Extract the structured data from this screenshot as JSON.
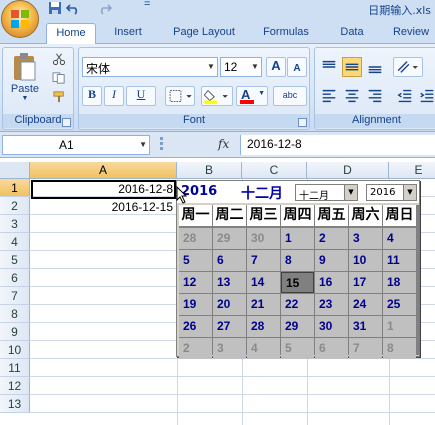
{
  "window": {
    "title": "日期输入.xls",
    "qa_more": "="
  },
  "tabs": [
    "Home",
    "Insert",
    "Page Layout",
    "Formulas",
    "Data",
    "Review"
  ],
  "ribbon": {
    "clipboard": {
      "paste": "Paste",
      "label": "Clipboard"
    },
    "font": {
      "name": "宋体",
      "size": "12",
      "grow": "A",
      "shrink": "A",
      "bold": "B",
      "italic": "I",
      "underline": "U",
      "font_color": "A",
      "phonetic": "abc",
      "label": "Font"
    },
    "alignment": {
      "label": "Alignment"
    }
  },
  "formula_bar": {
    "name_box": "A1",
    "fx": "fx",
    "formula": "2016-12-8"
  },
  "sheet": {
    "columns": [
      "A",
      "B",
      "C",
      "D",
      "E"
    ],
    "rows": [
      "1",
      "2",
      "3",
      "4",
      "5",
      "6",
      "7",
      "8",
      "9",
      "10",
      "11",
      "12",
      "13"
    ],
    "cells": {
      "A1": "2016-12-8",
      "A2": "2016-12-15"
    }
  },
  "calendar": {
    "year_label": "2016",
    "month_label": "十二月",
    "month_select": "十二月",
    "year_select": "2016",
    "weekdays": [
      "周一",
      "周二",
      "周三",
      "周四",
      "周五",
      "周六",
      "周日"
    ],
    "days": [
      [
        "28",
        "29",
        "30",
        "1",
        "2",
        "3",
        "4"
      ],
      [
        "5",
        "6",
        "7",
        "8",
        "9",
        "10",
        "11"
      ],
      [
        "12",
        "13",
        "14",
        "15",
        "16",
        "17",
        "18"
      ],
      [
        "19",
        "20",
        "21",
        "22",
        "23",
        "24",
        "25"
      ],
      [
        "26",
        "27",
        "28",
        "29",
        "30",
        "31",
        "1"
      ],
      [
        "2",
        "3",
        "4",
        "5",
        "6",
        "7",
        "8"
      ]
    ],
    "current_month_range": {
      "first_row_start_col": 3,
      "last_row_end_col": 5
    },
    "selected_day": "15"
  },
  "colors": {
    "accent": "#15428b",
    "calendar_day": "#00008b",
    "other_month": "#8a8a8a",
    "selected_bg": "#808080"
  }
}
